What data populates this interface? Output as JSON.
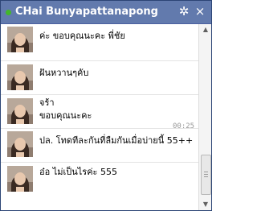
{
  "title_bar": {
    "title": "CHai Bunyapattanapong",
    "online_color": "#42b72a",
    "settings_icon": "gear-icon",
    "close_icon": "close-icon"
  },
  "messages": [
    {
      "lines": [
        "ค่ะ ขอบคุณนะคะ พี่ชัย"
      ],
      "timestamp": ""
    },
    {
      "lines": [
        "ฝันหวานๆคับ"
      ],
      "timestamp": ""
    },
    {
      "lines": [
        "จร้า",
        "ขอบคุณนะคะ"
      ],
      "timestamp": ""
    },
    {
      "lines": [
        "ปล. โทดทีละกันที่ลืมกันเมื่อบ่ายนี้ 55++"
      ],
      "timestamp": "00:25"
    },
    {
      "lines": [
        "อ๋อ ไม่เป็นไรค่ะ 555"
      ],
      "timestamp": ""
    }
  ],
  "colors": {
    "header": "#627aad",
    "border": "#2c4575"
  }
}
